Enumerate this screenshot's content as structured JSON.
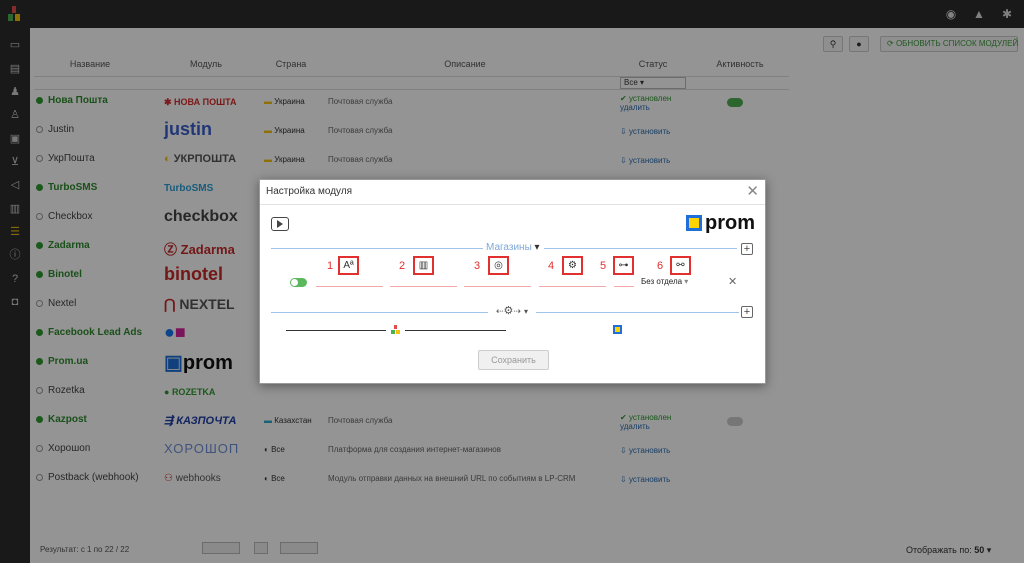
{
  "toolbar": {
    "update_label": "ОБНОВИТЬ СПИСОК МОДУЛЕЙ"
  },
  "table": {
    "headers": [
      "Название",
      "Модуль",
      "Страна",
      "Описание",
      "Статус",
      "Активность"
    ],
    "filter_status": "Все",
    "rows": [
      {
        "name": "Нова Пошта",
        "active": true,
        "logo": "НОВА ПОШТА",
        "country": "Украина",
        "desc": "Почтовая служба",
        "status": "установлен",
        "sub": "удалить"
      },
      {
        "name": "Justin",
        "active": false,
        "logo": "justin",
        "country": "Украина",
        "desc": "Почтовая служба",
        "status": "установить"
      },
      {
        "name": "УкрПошта",
        "active": false,
        "logo": "УКРПОШТА",
        "country": "Украина",
        "desc": "Почтовая служба",
        "status": "установить"
      },
      {
        "name": "TurboSMS",
        "active": true,
        "logo": "TurboSMS",
        "country": "",
        "desc": "",
        "status": ""
      },
      {
        "name": "Checkbox",
        "active": false,
        "logo": "checkbox",
        "country": "",
        "desc": "",
        "status": ""
      },
      {
        "name": "Zadarma",
        "active": true,
        "logo": "Zadarma",
        "country": "",
        "desc": "",
        "status": ""
      },
      {
        "name": "Binotel",
        "active": true,
        "logo": "binotel",
        "country": "",
        "desc": "",
        "status": ""
      },
      {
        "name": "Nextel",
        "active": false,
        "logo": "NEXTEL",
        "country": "",
        "desc": "",
        "status": ""
      },
      {
        "name": "Facebook Lead Ads",
        "active": true,
        "logo": "",
        "country": "",
        "desc": "",
        "status": ""
      },
      {
        "name": "Prom.ua",
        "active": true,
        "logo": "prom",
        "country": "",
        "desc": "",
        "status": ""
      },
      {
        "name": "Rozetka",
        "active": false,
        "logo": "ROZETKA",
        "country": "",
        "desc": "",
        "status": ""
      },
      {
        "name": "Kazpost",
        "active": true,
        "logo": "КАЗПОЧТА",
        "country": "Казахстан",
        "desc": "Почтовая служба",
        "status": "установлен",
        "sub": "удалить"
      },
      {
        "name": "Хорошоп",
        "active": false,
        "logo": "ХОРОШОП",
        "country": "Все",
        "desc": "Платформа для создания интернет-магазинов",
        "status": "установить"
      },
      {
        "name": "Postback (webhook)",
        "active": false,
        "logo": "webhooks",
        "country": "Все",
        "desc": "Модуль отправки данных на внешний URL по событиям в LP-CRM",
        "status": "установить"
      }
    ]
  },
  "footer": {
    "result": "Результат: с 1 по 22 / 22",
    "per_page_label": "Отображать по:",
    "per_page_value": "50"
  },
  "modal": {
    "title": "Настройка модуля",
    "brand": "prom",
    "section_label": "Магазины",
    "markers": [
      "1",
      "2",
      "3",
      "4",
      "5",
      "6"
    ],
    "field_icons": [
      "Aª",
      "▥",
      "◎",
      "⚙",
      "⊶",
      "⚯"
    ],
    "dept_label": "Без отдела",
    "save_label": "Сохранить"
  },
  "colors": {
    "accent_green": "#2e9a2e",
    "marker_red": "#e03030",
    "prom_blue": "#1e6fd9",
    "prom_yellow": "#fdd400"
  }
}
